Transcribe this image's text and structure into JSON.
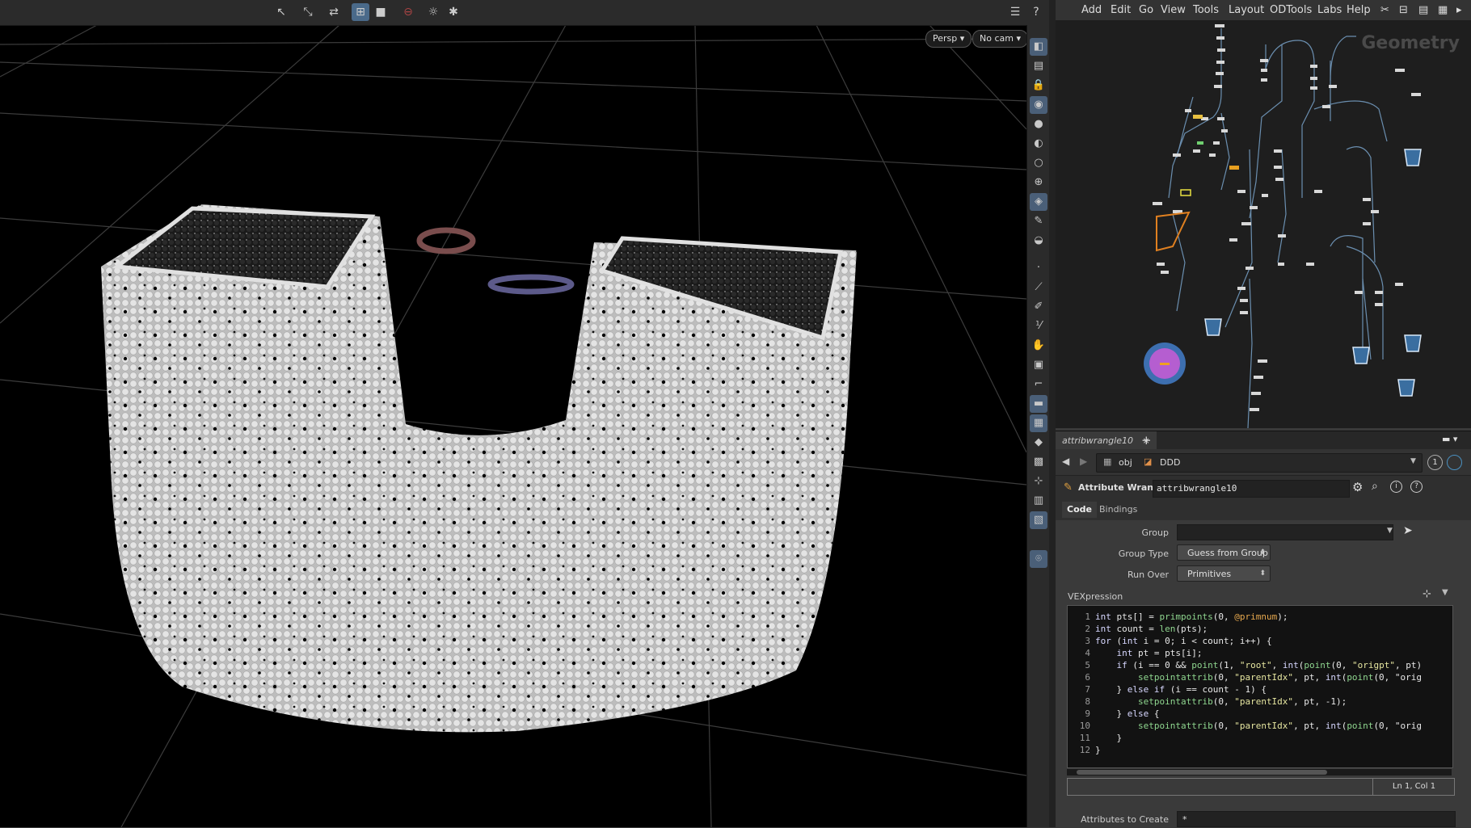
{
  "viewport": {
    "persp_label": "Persp ▾",
    "cam_label": "No cam ▾",
    "toolbar_icons": [
      "select-icon",
      "transform-icon",
      "rotate-icon",
      "snap-icon",
      "display-icon",
      "stop-icon",
      "lighting-icon",
      "render-icon"
    ]
  },
  "menubar": {
    "items": [
      "Add",
      "Edit",
      "Go",
      "View",
      "Tools",
      "Layout",
      "ODTools",
      "Labs",
      "Help"
    ]
  },
  "network": {
    "context_label": "Geometry"
  },
  "tabs": {
    "active_tab": "attribwrangle10",
    "close": "×",
    "add": "+"
  },
  "path": {
    "back": "◀",
    "forward": "▶",
    "root": "obj",
    "node": "DDD",
    "badge": "1"
  },
  "node_header": {
    "type": "Attribute Wrangle",
    "name": "attribwrangle10"
  },
  "param_tabs": [
    "Code",
    "Bindings"
  ],
  "params": {
    "group_label": "Group",
    "group_value": "",
    "group_type_label": "Group Type",
    "group_type_value": "Guess from Group",
    "run_over_label": "Run Over",
    "run_over_value": "Primitives",
    "vex_label": "VEXpression",
    "status": "Ln 1, Col 1",
    "attrs_label": "Attributes to Create",
    "attrs_value": "*"
  },
  "code_lines": [
    "int pts[] = primpoints(0, @primnum);",
    "int count = len(pts);",
    "for (int i = 0; i < count; i++) {",
    "    int pt = pts[i];",
    "    if (i == 0 && point(1, \"root\", int(point(0, \"origpt\", pt)",
    "        setpointattrib(0, \"parentIdx\", pt, int(point(0, \"orig",
    "    } else if (i == count - 1) {",
    "        setpointattrib(0, \"parentIdx\", pt, -1);",
    "    } else {",
    "        setpointattrib(0, \"parentIdx\", pt, int(point(0, \"orig",
    "    }",
    "}"
  ],
  "line_numbers": [
    "1",
    "2",
    "3",
    "4",
    "5",
    "6",
    "7",
    "8",
    "9",
    "10",
    "11",
    "12"
  ],
  "colors": {
    "accent": "#4a6a8a",
    "code_bg": "#121212",
    "viewport_bg": "#000000"
  }
}
